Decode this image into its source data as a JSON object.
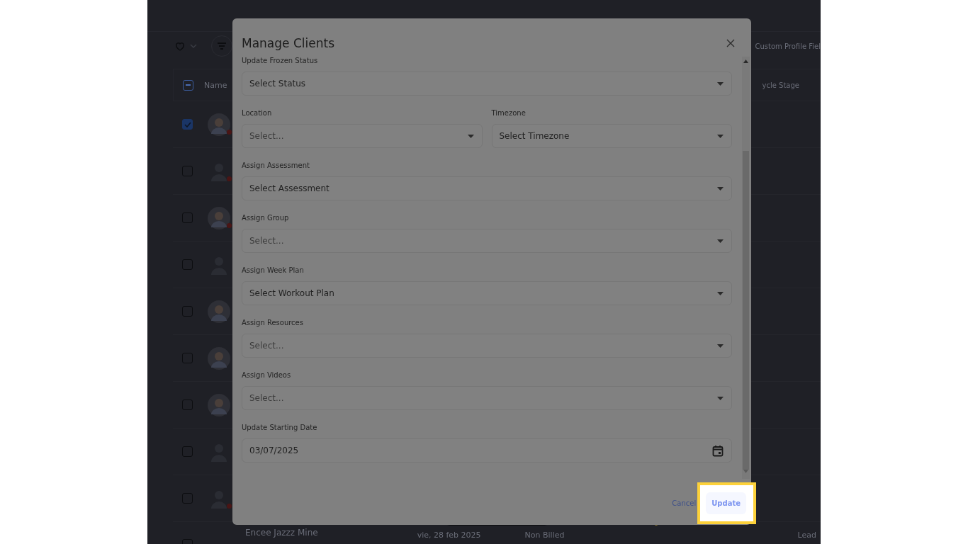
{
  "toolbar": {
    "custom_fields_button": "Custom Profile Fiel"
  },
  "table": {
    "columns": [
      {
        "label": "Name"
      },
      {
        "label": "ycle Stage"
      }
    ],
    "header_checkbox": {
      "indeterminate": true
    },
    "rows": [
      {
        "checked": true,
        "kind": "photo",
        "status_dot": true
      },
      {
        "checked": false,
        "kind": "placeholder",
        "status_dot": true
      },
      {
        "checked": false,
        "kind": "photo",
        "status_dot": true
      },
      {
        "checked": false,
        "kind": "placeholder",
        "status_dot": false
      },
      {
        "checked": false,
        "kind": "photo",
        "status_dot": false
      },
      {
        "checked": false,
        "kind": "photo",
        "status_dot": false
      },
      {
        "checked": false,
        "kind": "photo",
        "status_dot": false
      },
      {
        "checked": false,
        "kind": "placeholder",
        "status_dot": false
      },
      {
        "checked": false,
        "kind": "placeholder",
        "status_dot": true
      }
    ],
    "last_row": {
      "checked": false,
      "name": "Encee Jazzz Mine",
      "date": "vie, 28 feb 2025",
      "billing": "Non Billed",
      "stage": "Lead"
    }
  },
  "modal": {
    "title": "Manage Clients",
    "fields": [
      {
        "kind": "select",
        "label": "Update Frozen Status",
        "placeholder": "Select Status",
        "filled": true
      },
      {
        "kind": "pair",
        "items": [
          {
            "label": "Location",
            "placeholder": "Select...",
            "filled": false
          },
          {
            "label": "Timezone",
            "placeholder": "Select Timezone",
            "filled": true
          }
        ]
      },
      {
        "kind": "select",
        "label": "Assign Assessment",
        "placeholder": "Select Assessment",
        "filled": true
      },
      {
        "kind": "select",
        "label": "Assign Group",
        "placeholder": "Select...",
        "filled": false
      },
      {
        "kind": "select",
        "label": "Assign Week Plan",
        "placeholder": "Select Workout Plan",
        "filled": true
      },
      {
        "kind": "select",
        "label": "Assign Resources",
        "placeholder": "Select...",
        "filled": false
      },
      {
        "kind": "select",
        "label": "Assign Videos",
        "placeholder": "Select...",
        "filled": false
      },
      {
        "kind": "date",
        "label": "Update Starting Date",
        "value": "03/07/2025"
      }
    ],
    "buttons": [
      {
        "kind": "link",
        "label": "Cancel",
        "highlighted": false
      },
      {
        "kind": "primary",
        "label": "Update",
        "highlighted": true
      }
    ]
  }
}
